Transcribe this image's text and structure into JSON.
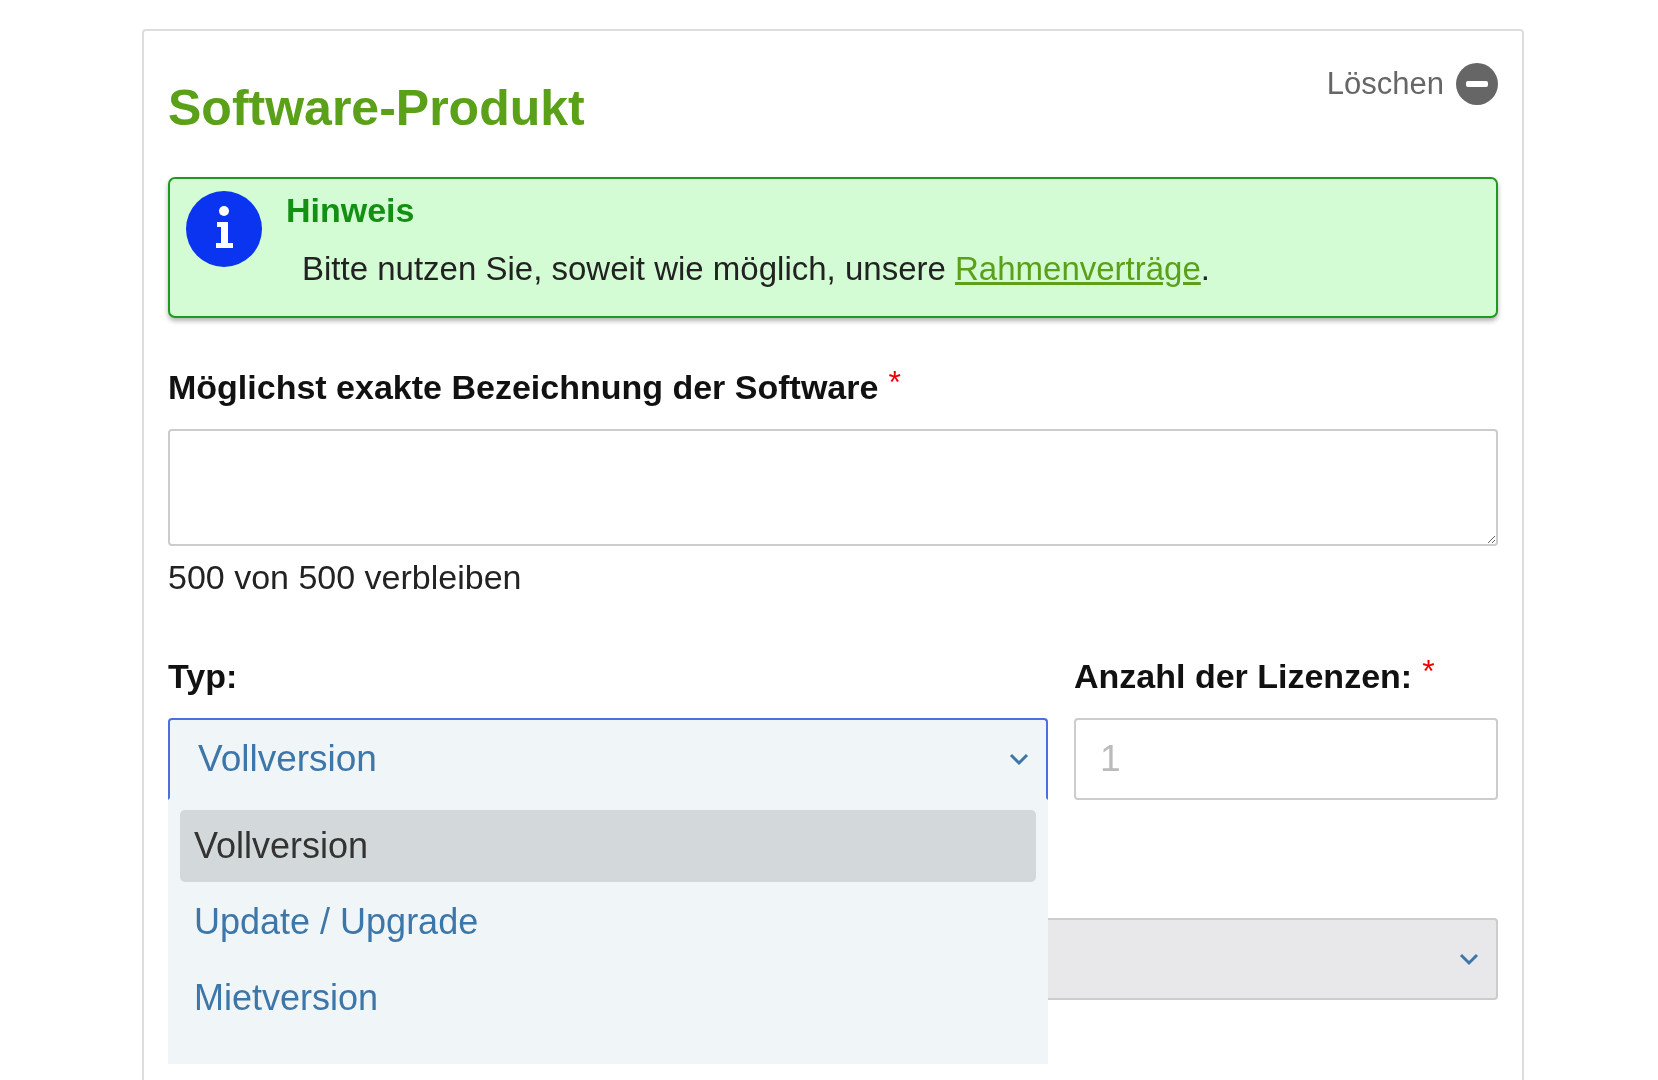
{
  "card": {
    "title": "Software-Produkt",
    "delete_label": "Löschen"
  },
  "notice": {
    "title": "Hinweis",
    "text": "Bitte nutzen Sie, soweit wie möglich, unsere ",
    "link": "Rahmenverträge",
    "after": "."
  },
  "software_field": {
    "label": "Möglichst exakte Bezeichnung der Software",
    "required_mark": "*",
    "counter": "500 von 500 verbleiben"
  },
  "type_field": {
    "label": "Typ:",
    "value": "Vollversion",
    "expanded": true,
    "options": [
      {
        "label": "Vollversion",
        "selected": true
      },
      {
        "label": "Update / Upgrade",
        "selected": false
      },
      {
        "label": "Mietversion",
        "selected": false
      }
    ]
  },
  "licenses_field": {
    "label": "Anzahl der Lizenzen:",
    "required_mark": "*",
    "placeholder": "1"
  },
  "third_select": {
    "disabled": true
  }
}
